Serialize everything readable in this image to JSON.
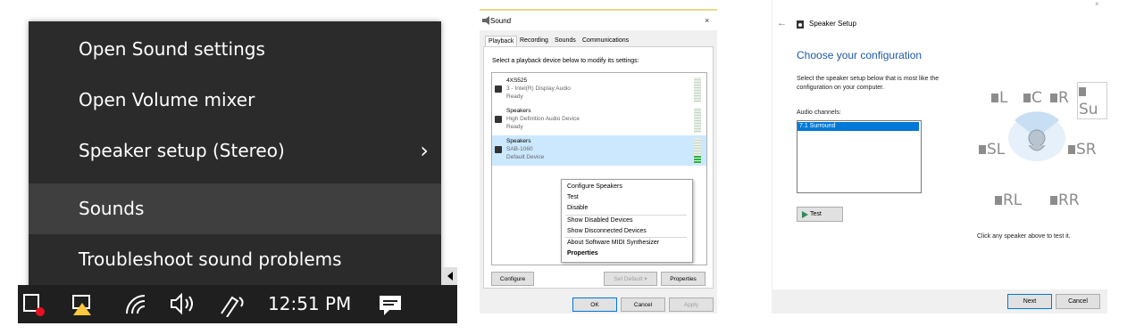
{
  "panel1": {
    "menu_items": [
      {
        "label": "Open Sound settings"
      },
      {
        "label": "Open Volume mixer"
      },
      {
        "label": "Speaker setup (Stereo)",
        "submenu": true
      },
      {
        "label": "Sounds",
        "highlighted": true
      },
      {
        "label": "Troubleshoot sound problems"
      }
    ],
    "chevron": "›",
    "taskbar": {
      "clock": "12:51 PM",
      "icons": [
        "action-center-icon",
        "network-warning-icon",
        "wifi-icon",
        "volume-icon",
        "pen-icon",
        "notification-icon"
      ]
    }
  },
  "panel2": {
    "title": "Sound",
    "close": "×",
    "tabs": [
      "Playback",
      "Recording",
      "Sounds",
      "Communications"
    ],
    "instruction": "Select a playback device below to modify its settings:",
    "devices": [
      {
        "line1": "4XS525",
        "line2": "3 - Intel(R) Display Audio",
        "line3": "Ready",
        "level": 0
      },
      {
        "line1": "Speakers",
        "line2": "High Definition Audio Device",
        "line3": "Ready",
        "level": 0
      },
      {
        "line1": "Speakers",
        "line2": "SAB-1060",
        "line3": "Default Device",
        "selected": true,
        "level": 0.3
      }
    ],
    "context_menu": [
      "Configure Speakers",
      "Test",
      "Disable",
      "Show Disabled Devices",
      "Show Disconnected Devices",
      "About Software MIDI Synthesizer",
      "Properties"
    ],
    "buttons": {
      "configure": "Configure",
      "set_default": "Set Default",
      "properties": "Properties",
      "ok": "OK",
      "cancel": "Cancel",
      "apply": "Apply"
    }
  },
  "panel3": {
    "back": "←",
    "title": "Speaker Setup",
    "close": "×",
    "heading": "Choose your configuration",
    "instruction": "Select the speaker setup below that is most like the configuration on your computer.",
    "audio_channels_label": "Audio channels:",
    "channels": [
      "7.1 Surround"
    ],
    "test_button": "Test",
    "speakers": {
      "fl": "L",
      "c": "C",
      "fr": "R",
      "sub": "Su",
      "sl": "SL",
      "sr": "SR",
      "rl": "RL",
      "rr": "RR"
    },
    "hint": "Click any speaker above to test it.",
    "buttons": {
      "next": "Next",
      "cancel": "Cancel"
    }
  }
}
